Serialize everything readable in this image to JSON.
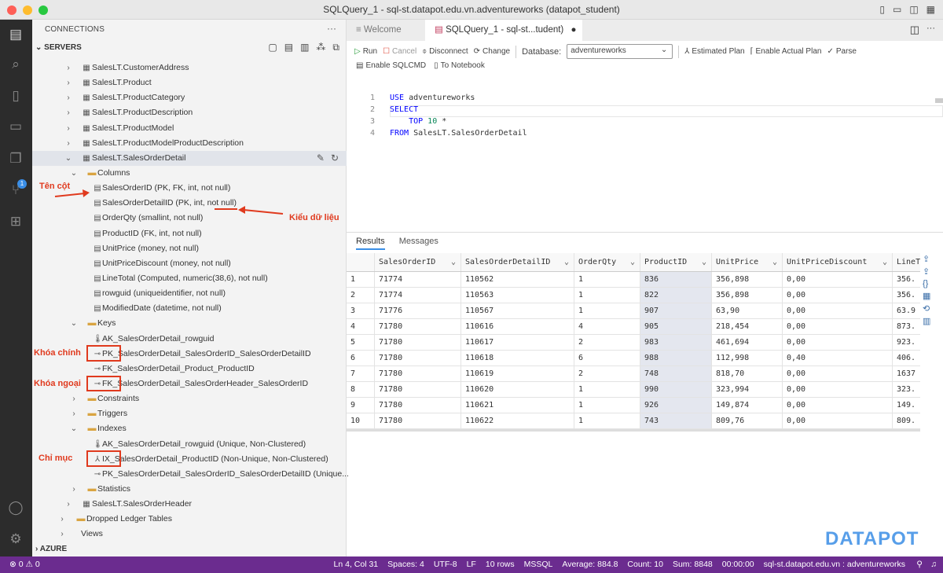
{
  "window": {
    "title": "SQLQuery_1 - sql-st.datapot.edu.vn.adventureworks (datapot_student)"
  },
  "sidebar": {
    "header": "CONNECTIONS",
    "servers_label": "SERVERS",
    "azure_label": "AZURE",
    "tree": [
      {
        "label": "SalesLT.CustomerAddress",
        "level": 1,
        "icon": "table-icon",
        "chev": "right"
      },
      {
        "label": "SalesLT.Product",
        "level": 1,
        "icon": "table-icon",
        "chev": "right"
      },
      {
        "label": "SalesLT.ProductCategory",
        "level": 1,
        "icon": "table-icon",
        "chev": "right"
      },
      {
        "label": "SalesLT.ProductDescription",
        "level": 1,
        "icon": "table-icon",
        "chev": "right"
      },
      {
        "label": "SalesLT.ProductModel",
        "level": 1,
        "icon": "table-icon",
        "chev": "right"
      },
      {
        "label": "SalesLT.ProductModelProductDescription",
        "level": 1,
        "icon": "table-icon",
        "chev": "right"
      },
      {
        "label": "SalesLT.SalesOrderDetail",
        "level": 1,
        "icon": "table-icon",
        "chev": "down",
        "selected": true
      },
      {
        "label": "Columns",
        "level": 2,
        "icon": "folder-icon",
        "chev": "down"
      },
      {
        "label": "SalesOrderID (PK, FK, int, not null)",
        "level": 3,
        "icon": "column-icon"
      },
      {
        "label": "SalesOrderDetailID (PK, int, not null)",
        "level": 3,
        "icon": "column-icon"
      },
      {
        "label": "OrderQty (smallint, not null)",
        "level": 3,
        "icon": "column-icon"
      },
      {
        "label": "ProductID (FK, int, not null)",
        "level": 3,
        "icon": "column-icon"
      },
      {
        "label": "UnitPrice (money, not null)",
        "level": 3,
        "icon": "column-icon"
      },
      {
        "label": "UnitPriceDiscount (money, not null)",
        "level": 3,
        "icon": "column-icon"
      },
      {
        "label": "LineTotal (Computed, numeric(38,6), not null)",
        "level": 3,
        "icon": "column-icon"
      },
      {
        "label": "rowguid (uniqueidentifier, not null)",
        "level": 3,
        "icon": "column-icon"
      },
      {
        "label": "ModifiedDate (datetime, not null)",
        "level": 3,
        "icon": "column-icon"
      },
      {
        "label": "Keys",
        "level": 2,
        "icon": "folder-icon",
        "chev": "down"
      },
      {
        "label": "AK_SalesOrderDetail_rowguid",
        "level": 3,
        "icon": "unique-key-icon"
      },
      {
        "label": "PK_SalesOrderDetail_SalesOrderID_SalesOrderDetailID",
        "level": 3,
        "icon": "primary-key-icon"
      },
      {
        "label": "FK_SalesOrderDetail_Product_ProductID",
        "level": 3,
        "icon": "foreign-key-icon"
      },
      {
        "label": "FK_SalesOrderDetail_SalesOrderHeader_SalesOrderID",
        "level": 3,
        "icon": "foreign-key-icon"
      },
      {
        "label": "Constraints",
        "level": 2,
        "icon": "folder-icon",
        "chev": "right"
      },
      {
        "label": "Triggers",
        "level": 2,
        "icon": "folder-icon",
        "chev": "right"
      },
      {
        "label": "Indexes",
        "level": 2,
        "icon": "folder-icon",
        "chev": "down"
      },
      {
        "label": "AK_SalesOrderDetail_rowguid (Unique, Non-Clustered)",
        "level": 3,
        "icon": "unique-key-icon"
      },
      {
        "label": "IX_SalesOrderDetail_ProductID (Non-Unique, Non-Clustered)",
        "level": 3,
        "icon": "index-icon"
      },
      {
        "label": "PK_SalesOrderDetail_SalesOrderID_SalesOrderDetailID (Unique...",
        "level": 3,
        "icon": "primary-key-icon"
      },
      {
        "label": "Statistics",
        "level": 2,
        "icon": "folder-icon",
        "chev": "right"
      },
      {
        "label": "SalesLT.SalesOrderHeader",
        "level": 1,
        "icon": "table-icon",
        "chev": "right"
      },
      {
        "label": "Dropped Ledger Tables",
        "level": 0,
        "icon": "folder-icon",
        "chev": "right"
      },
      {
        "label": "Views",
        "level": 0,
        "icon": "folder-icon",
        "chev": "right",
        "plain": true
      }
    ]
  },
  "annotations": {
    "column_name": "Tên cột",
    "data_type": "Kiểu dữ liệu",
    "primary_key": "Khóa chính",
    "foreign_key": "Khóa ngoại",
    "index": "Chỉ mục",
    "color": "#e03a1e"
  },
  "tabs": [
    {
      "label": "Welcome"
    },
    {
      "label": "SQLQuery_1 - sql-st...tudent)",
      "active": true,
      "dirty": "●"
    }
  ],
  "toolbar": {
    "run": "Run",
    "cancel": "Cancel",
    "disconnect": "Disconnect",
    "change": "Change",
    "database_label": "Database:",
    "database_value": "adventureworks",
    "estimated_plan": "Estimated Plan",
    "actual_plan": "Enable Actual Plan",
    "parse": "Parse",
    "sqlcmd": "Enable SQLCMD",
    "notebook": "To Notebook"
  },
  "editor": {
    "lines": [
      [
        {
          "t": "USE ",
          "c": "kw"
        },
        {
          "t": "adventureworks"
        }
      ],
      [
        {
          "t": "SELECT",
          "c": "kw"
        }
      ],
      [
        {
          "t": "    TOP ",
          "c": "kw"
        },
        {
          "t": "10",
          "c": "num"
        },
        {
          "t": " *"
        }
      ],
      [
        {
          "t": "FROM ",
          "c": "kw"
        },
        {
          "t": "SalesLT.SalesOrderDetail"
        }
      ]
    ]
  },
  "results": {
    "tabs": [
      "Results",
      "Messages"
    ],
    "columns": [
      "",
      "SalesOrderID",
      "SalesOrderDetailID",
      "OrderQty",
      "ProductID",
      "UnitPrice",
      "UnitPriceDiscount",
      "LineT"
    ],
    "rows": [
      [
        "1",
        "71774",
        "110562",
        "1",
        "836",
        "356,898",
        "0,00",
        "356."
      ],
      [
        "2",
        "71774",
        "110563",
        "1",
        "822",
        "356,898",
        "0,00",
        "356."
      ],
      [
        "3",
        "71776",
        "110567",
        "1",
        "907",
        "63,90",
        "0,00",
        "63.9"
      ],
      [
        "4",
        "71780",
        "110616",
        "4",
        "905",
        "218,454",
        "0,00",
        "873."
      ],
      [
        "5",
        "71780",
        "110617",
        "2",
        "983",
        "461,694",
        "0,00",
        "923."
      ],
      [
        "6",
        "71780",
        "110618",
        "6",
        "988",
        "112,998",
        "0,40",
        "406."
      ],
      [
        "7",
        "71780",
        "110619",
        "2",
        "748",
        "818,70",
        "0,00",
        "1637"
      ],
      [
        "8",
        "71780",
        "110620",
        "1",
        "990",
        "323,994",
        "0,00",
        "323."
      ],
      [
        "9",
        "71780",
        "110621",
        "1",
        "926",
        "149,874",
        "0,00",
        "149."
      ],
      [
        "10",
        "71780",
        "110622",
        "1",
        "743",
        "809,76",
        "0,00",
        "809."
      ]
    ]
  },
  "status": {
    "errors": "0",
    "warnings": "0",
    "position": "Ln 4, Col 31",
    "spaces": "Spaces: 4",
    "encoding": "UTF-8",
    "eol": "LF",
    "rows": "10 rows",
    "language": "MSSQL",
    "average": "Average: 884.8",
    "count": "Count: 10",
    "sum": "Sum: 8848",
    "time": "00:00:00",
    "connection": "sql-st.datapot.edu.vn : adventureworks",
    "bg_color": "#6b2c8f"
  },
  "logo": "DATAPOT"
}
